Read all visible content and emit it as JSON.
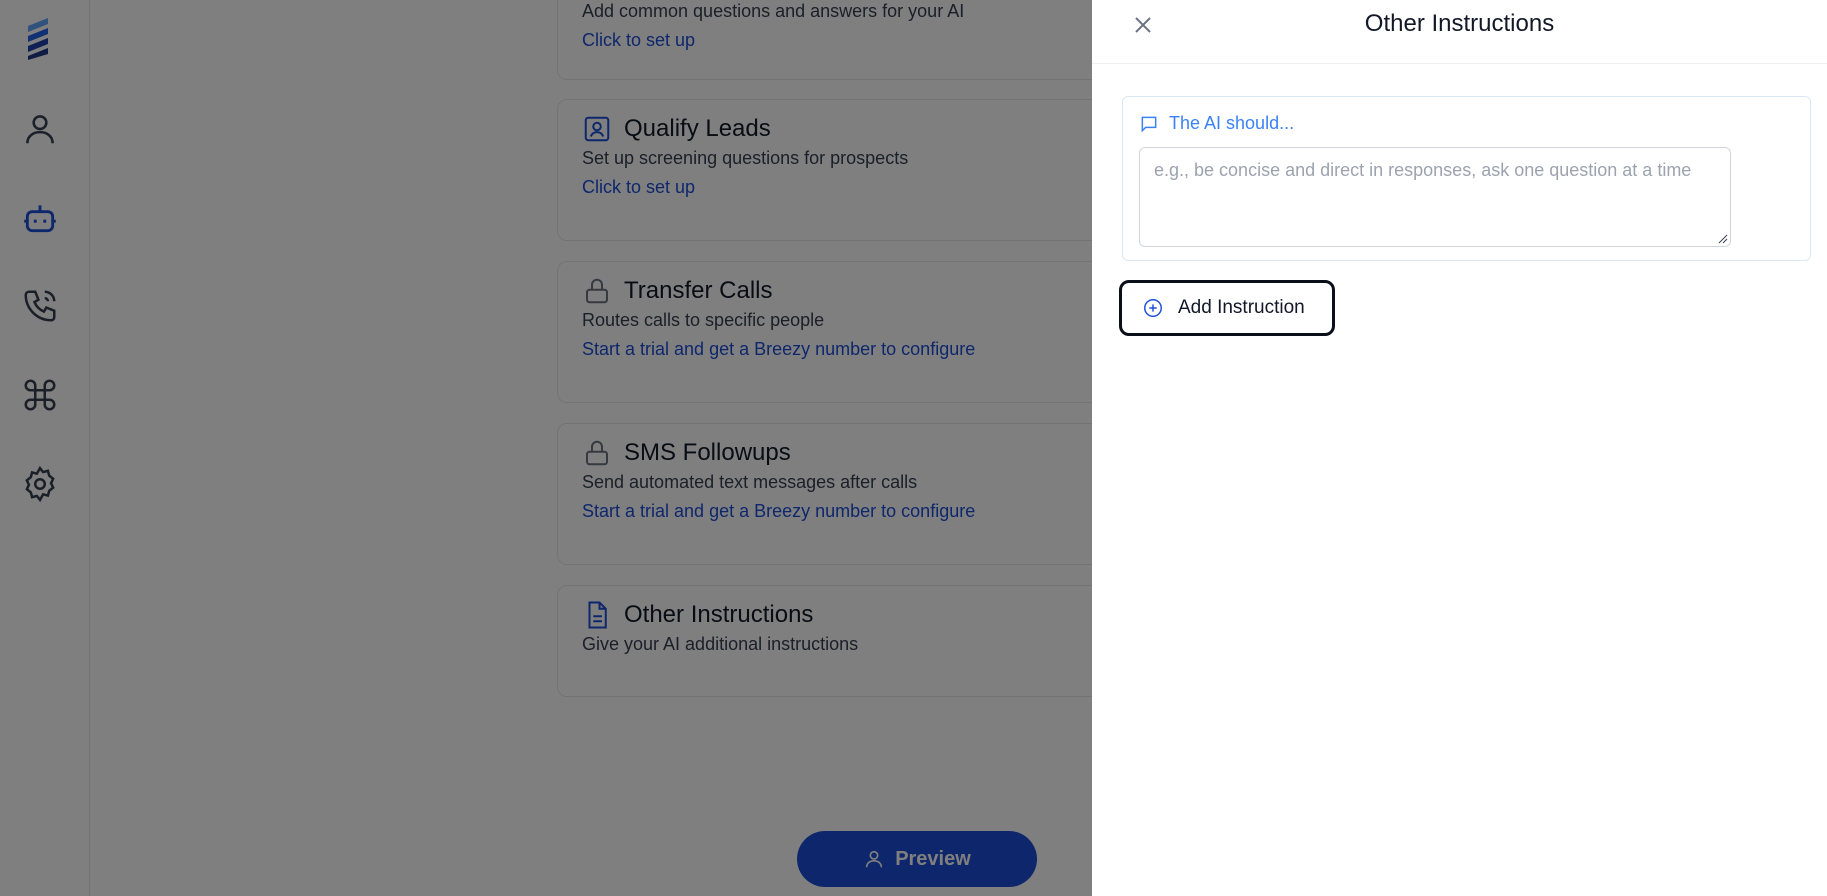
{
  "cards": [
    {
      "title": "",
      "description": "Add common questions and answers for your AI",
      "link": "Click to set up",
      "icon": "none"
    },
    {
      "title": "Qualify Leads",
      "description": "Set up screening questions for prospects",
      "link": "Click to set up",
      "icon": "contact-card-icon"
    },
    {
      "title": "Transfer Calls",
      "description": "Routes calls to specific people",
      "link": "Start a trial and get a Breezy number to configure",
      "icon": "lock-icon"
    },
    {
      "title": "SMS Followups",
      "description": "Send automated text messages after calls",
      "link": "Start a trial and get a Breezy number to configure",
      "icon": "lock-icon"
    },
    {
      "title": "Other Instructions",
      "description": "Give your AI additional instructions",
      "link": "",
      "icon": "document-icon"
    }
  ],
  "preview_button": {
    "label": "Preview"
  },
  "sidebar": {
    "items": [
      {
        "name": "logo",
        "icon": "logo-icon"
      },
      {
        "name": "contacts",
        "icon": "user-icon"
      },
      {
        "name": "agent",
        "icon": "robot-icon"
      },
      {
        "name": "calls",
        "icon": "phone-icon"
      },
      {
        "name": "shortcuts",
        "icon": "command-icon"
      },
      {
        "name": "settings",
        "icon": "gear-icon"
      }
    ]
  },
  "drawer": {
    "title": "Other Instructions",
    "field_label": "The AI should...",
    "textarea_placeholder": "e.g., be concise and direct in responses, ask one question at a time",
    "textarea_value": "",
    "add_button_label": "Add Instruction"
  },
  "colors": {
    "accent": "#1d4ed8",
    "label_blue": "#3b82f6",
    "overlay": "rgba(0,0,0,0.5)"
  }
}
